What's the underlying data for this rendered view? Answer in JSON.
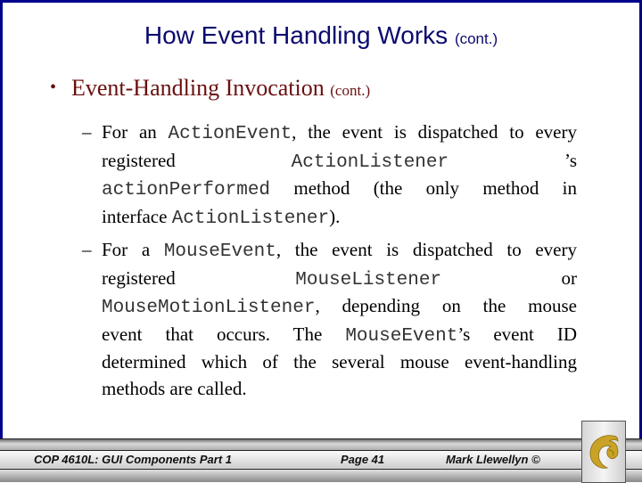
{
  "title": {
    "main": "How Event Handling Works",
    "suffix": "(cont.)"
  },
  "bullet": {
    "symbol": "•",
    "text": "Event-Handling Invocation",
    "suffix": "(cont.)"
  },
  "sub_items": [
    {
      "dash": "–",
      "lines": [
        [
          {
            "t": "For an "
          },
          {
            "m": "ActionEvent"
          },
          {
            "t": ", the event is dispatched to every"
          }
        ],
        [
          {
            "t": "registered"
          },
          {
            "m": "ActionListener"
          },
          {
            "t": "’s"
          }
        ],
        [
          {
            "m": "actionPerformed"
          },
          {
            "t": " method (the only method in"
          }
        ],
        [
          {
            "t": "interface "
          },
          {
            "m": "ActionListener"
          },
          {
            "t": ")."
          }
        ]
      ]
    },
    {
      "dash": "–",
      "lines": [
        [
          {
            "t": "For a "
          },
          {
            "m": "MouseEvent"
          },
          {
            "t": ", the event is dispatched to every"
          }
        ],
        [
          {
            "t": "registered"
          },
          {
            "m": "MouseListener"
          },
          {
            "t": "or"
          }
        ],
        [
          {
            "m": "MouseMotionListener"
          },
          {
            "t": ", depending on the mouse"
          }
        ],
        [
          {
            "t": "event that occurs.  The "
          },
          {
            "m": "MouseEvent"
          },
          {
            "t": "’s event ID"
          }
        ],
        [
          {
            "t": "determined which of the several mouse event-handling"
          }
        ],
        [
          {
            "t": "methods are called."
          }
        ]
      ]
    }
  ],
  "footer": {
    "course": "COP 4610L: GUI Components Part 1",
    "page": "Page 41",
    "author": "Mark Llewellyn ©",
    "logo_icon": "pegasus-logo-icon"
  },
  "colors": {
    "frame": "#00008b",
    "title": "#0a0a6e",
    "bullet": "#6b0f0f",
    "logo": "#c9a227"
  }
}
